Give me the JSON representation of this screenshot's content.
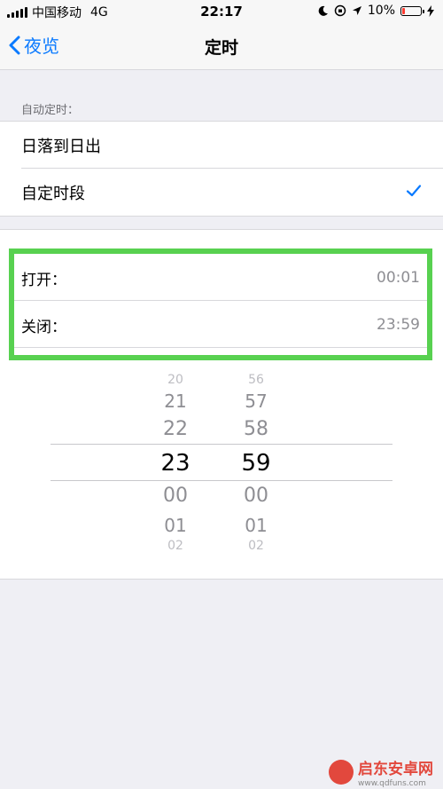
{
  "status_bar": {
    "carrier": "中国移动",
    "network": "4G",
    "time": "22:17",
    "battery": "10%"
  },
  "nav": {
    "back_label": "夜览",
    "title": "定时"
  },
  "auto_schedule": {
    "header": "自动定时：",
    "options": [
      {
        "label": "日落到日出",
        "selected": false
      },
      {
        "label": "自定时段",
        "selected": true
      }
    ]
  },
  "schedule_times": {
    "on_label": "打开：",
    "on_value": "00:01",
    "off_label": "关闭：",
    "off_value": "23:59"
  },
  "picker": {
    "hours": [
      "20",
      "21",
      "22",
      "23",
      "00",
      "01",
      "02"
    ],
    "minutes": [
      "56",
      "57",
      "58",
      "59",
      "00",
      "01",
      "02"
    ],
    "selected_hour": "23",
    "selected_minute": "59"
  },
  "watermark": {
    "brand": "启东安卓网",
    "url": "www.qdfuns.com"
  },
  "colors": {
    "accent": "#0a7aff",
    "highlight": "#58d150",
    "battery_low": "#ff3b30"
  }
}
